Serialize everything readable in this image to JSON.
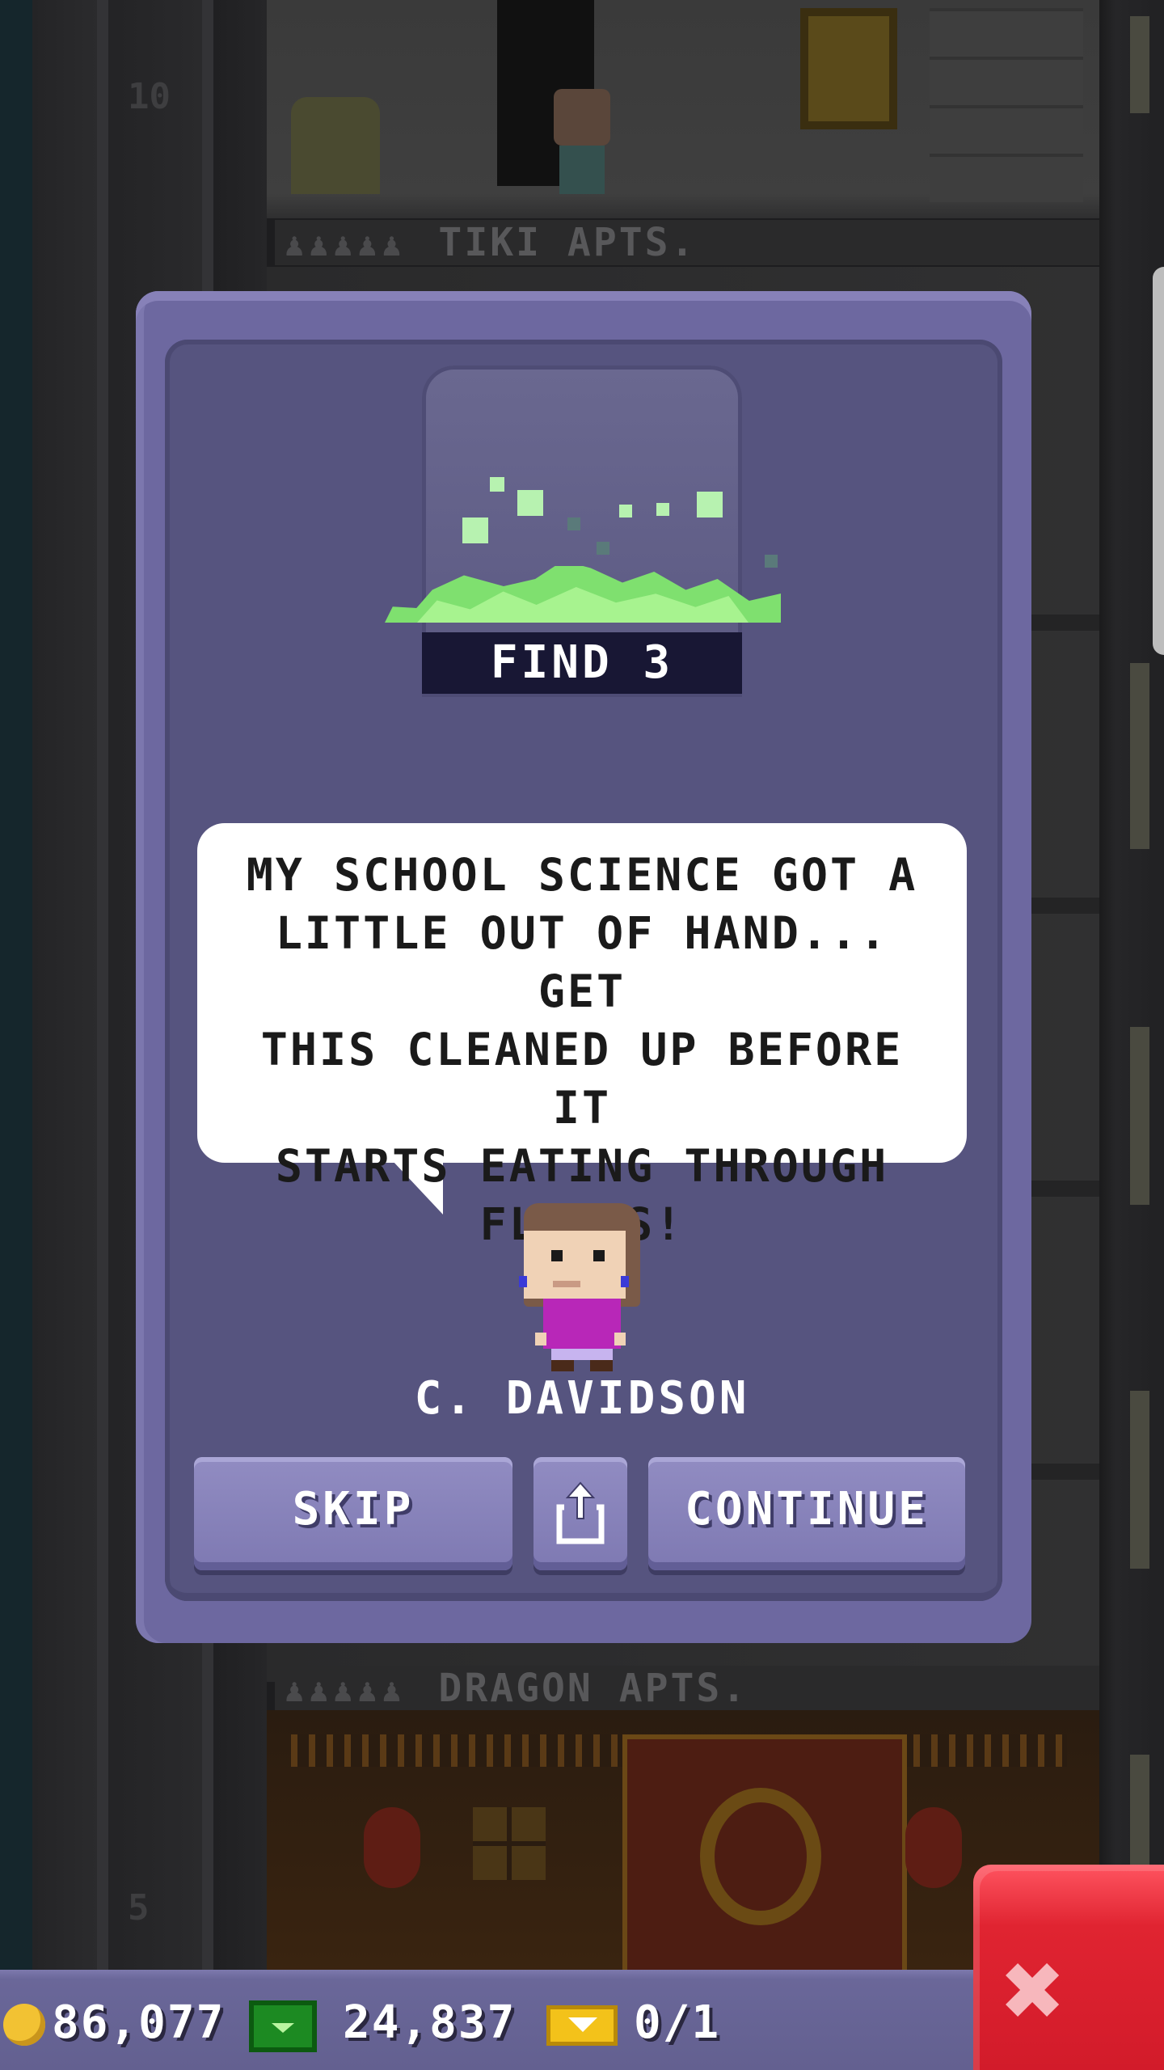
{
  "background": {
    "floor_top_number": "10",
    "floor_top_label": "TIKI APTS.",
    "floor_bottom_number": "5",
    "floor_bottom_label": "DRAGON APTS.",
    "people_icons": "♟♟♟♟♟"
  },
  "dialog": {
    "objective_label": "FIND 3",
    "speech_text": "MY SCHOOL SCIENCE GOT A\nLITTLE OUT OF HAND... GET\nTHIS CLEANED UP BEFORE IT\nSTARTS EATING THROUGH\nFLOORS!",
    "npc_name": "C. DAVIDSON",
    "buttons": {
      "skip_label": "SKIP",
      "share_icon": "share-icon",
      "continue_label": "CONTINUE"
    }
  },
  "status_bar": {
    "coins": "86,077",
    "bux": "24,837",
    "tickets": "0/1"
  },
  "colors": {
    "dialog_frame": "#6d68a0",
    "dialog_panel": "#56547f",
    "button": "#8782bb",
    "slime": "#8ef67e",
    "close_button": "#e02431"
  }
}
